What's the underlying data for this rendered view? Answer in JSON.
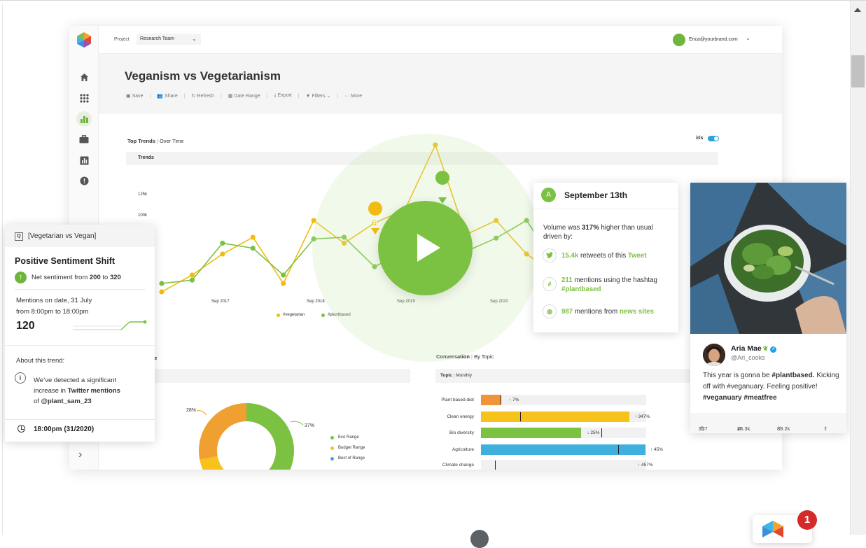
{
  "topbar": {
    "project_label": "Project",
    "project_value": "Research Team",
    "user_email": "Erica@yourbrand.com"
  },
  "page": {
    "title": "Veganism vs Vegetarianism"
  },
  "toolbar": {
    "save": "Save",
    "share": "Share",
    "refresh": "Refresh",
    "date_range": "Date Range",
    "export": "Export",
    "filters": "Filters",
    "more": "More"
  },
  "top_trends": {
    "title": "Top Trends",
    "subtitle": "Over Time",
    "iris_label": "iris",
    "section_label": "Trends"
  },
  "chart_data": [
    {
      "type": "line",
      "title": "Trends",
      "y_ticks": [
        "125k",
        "100k"
      ],
      "x_ticks": [
        "Sep 2017",
        "Sep 2018",
        "Sep 2019",
        "Sep 2020"
      ],
      "series": [
        {
          "name": "#vegetarian",
          "color": "#f2bb14",
          "values": [
            10,
            30,
            55,
            75,
            20,
            95,
            68,
            92,
            108,
            185,
            78,
            95,
            55,
            30,
            10
          ]
        },
        {
          "name": "#plantbased",
          "color": "#7cc242",
          "values": [
            20,
            24,
            68,
            62,
            30,
            73,
            75,
            40,
            58,
            75,
            58,
            74,
            95,
            40,
            40
          ]
        }
      ],
      "annotations": [
        "A",
        "B"
      ]
    },
    {
      "type": "pie",
      "title": "Share of Voice",
      "labels_shown": [
        "28%",
        "37%"
      ],
      "slices": [
        {
          "name": "Eco Range",
          "color": "#7cc242",
          "value": 37
        },
        {
          "name": "Budget Range",
          "color": "#f0a030",
          "value": 28
        },
        {
          "name": "Best of Range",
          "color": "#3fa9d9",
          "value": 35
        }
      ]
    },
    {
      "type": "bar",
      "title": "Conversation",
      "subtitle": "By Topic",
      "topic_label": "Topic",
      "period_label": "Monthly",
      "categories": [
        "Plant based diet",
        "Clean energy",
        "Bio diversity",
        "Agricolture",
        "Climate change"
      ],
      "values": [
        12,
        90,
        61,
        100,
        0
      ],
      "changes": [
        "7%",
        "347%",
        "25%",
        "45%",
        "457%"
      ],
      "change_dir": [
        "up",
        "up",
        "down",
        "up",
        "up"
      ],
      "colors": [
        "#f0943a",
        "#f7c21c",
        "#7cc242",
        "#3fb0dd",
        "#cccccc"
      ]
    }
  ],
  "overlay_marks": {
    "a": "A",
    "b": "B"
  },
  "sentiment_card": {
    "query": "[Vegetarian vs Vegan]",
    "title": "Positive Sentiment Shift",
    "net_prefix": "Net sentiment from",
    "net_from": "200",
    "net_to_word": "to",
    "net_to": "320",
    "mentions_line1": "Mentions on date, 31 July",
    "mentions_line2": "from 8:00pm to 18:00pm",
    "count": "120",
    "about": "About this trend:",
    "detect_line1": "We’ve detected a significant",
    "detect_line2_prefix": "increase in",
    "detect_line2_bold": "Twitter mentions",
    "detect_line3_prefix": "of",
    "detect_line3_bold": "@plant_sam_23",
    "time": "18:00pm (31/2020)"
  },
  "insight_card": {
    "badge": "A",
    "date": "September 13th",
    "vol_prefix": "Volume was",
    "vol_pct": "317%",
    "vol_suffix": "higher than usual driven by:",
    "r1_count": "15.4k",
    "r1_mid": "retweets of this",
    "r1_link": "Tweet",
    "r2_count": "211",
    "r2_mid": "mentions using the hashtag",
    "r2_link": "#plantbased",
    "r3_count": "987",
    "r3_mid": "mentions from",
    "r3_link": "news sites"
  },
  "tweet_card": {
    "name": "Aria Mae",
    "handle": "@Ari_cooks",
    "text_1": "This year is gonna be",
    "text_2": "#plantbased.",
    "text_3": "Kicking off with #veganuary. Feeling positive!",
    "text_4": "#veganuary #meatfree",
    "replies": "357",
    "retweets": "25.3k",
    "likes": "89.2k"
  },
  "notification": {
    "badge_count": "1"
  }
}
